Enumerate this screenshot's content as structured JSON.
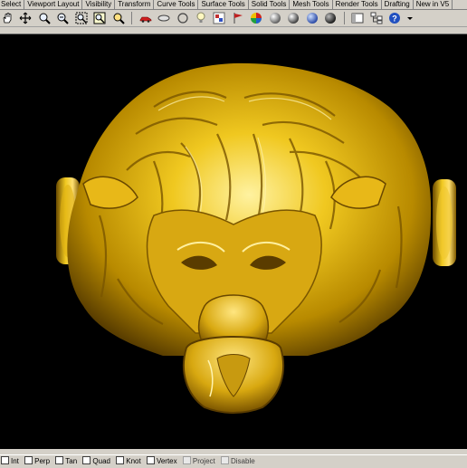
{
  "toolbar_tabs": [
    "Select",
    "Viewport Layout",
    "Visibility",
    "Transform",
    "Curve Tools",
    "Surface Tools",
    "Solid Tools",
    "Mesh Tools",
    "Render Tools",
    "Drafting",
    "New in V5"
  ],
  "toolbar_icons": [
    "pan-hand-icon",
    "rotate-view-icon",
    "zoom-icon",
    "zoom-window-icon",
    "zoom-extents-icon",
    "zoom-selected-icon",
    "zoom-dynamic-icon",
    "car-model-icon",
    "ellipse-icon",
    "circle-outline-icon",
    "lamp-icon",
    "material-swatch-icon",
    "flag-icon",
    "color-wheel-icon",
    "sphere-shaded-icon",
    "sphere-render-icon",
    "sphere-blue-icon",
    "sphere-dark-icon",
    "toggle-panel-icon",
    "hierarchy-icon",
    "help-icon",
    "dropdown-arrow-icon"
  ],
  "status_bar": {
    "snaps": [
      {
        "label": "Int",
        "checked": false,
        "enabled": true
      },
      {
        "label": "Perp",
        "checked": false,
        "enabled": true
      },
      {
        "label": "Tan",
        "checked": false,
        "enabled": true
      },
      {
        "label": "Quad",
        "checked": false,
        "enabled": true
      },
      {
        "label": "Knot",
        "checked": false,
        "enabled": true
      },
      {
        "label": "Vertex",
        "checked": false,
        "enabled": true
      },
      {
        "label": "Project",
        "checked": false,
        "enabled": false
      },
      {
        "label": "Disable",
        "checked": false,
        "enabled": false
      }
    ]
  },
  "viewport": {
    "background": "#000000",
    "model_color": "#c8a000",
    "model": "gold-lion-head-ring"
  }
}
